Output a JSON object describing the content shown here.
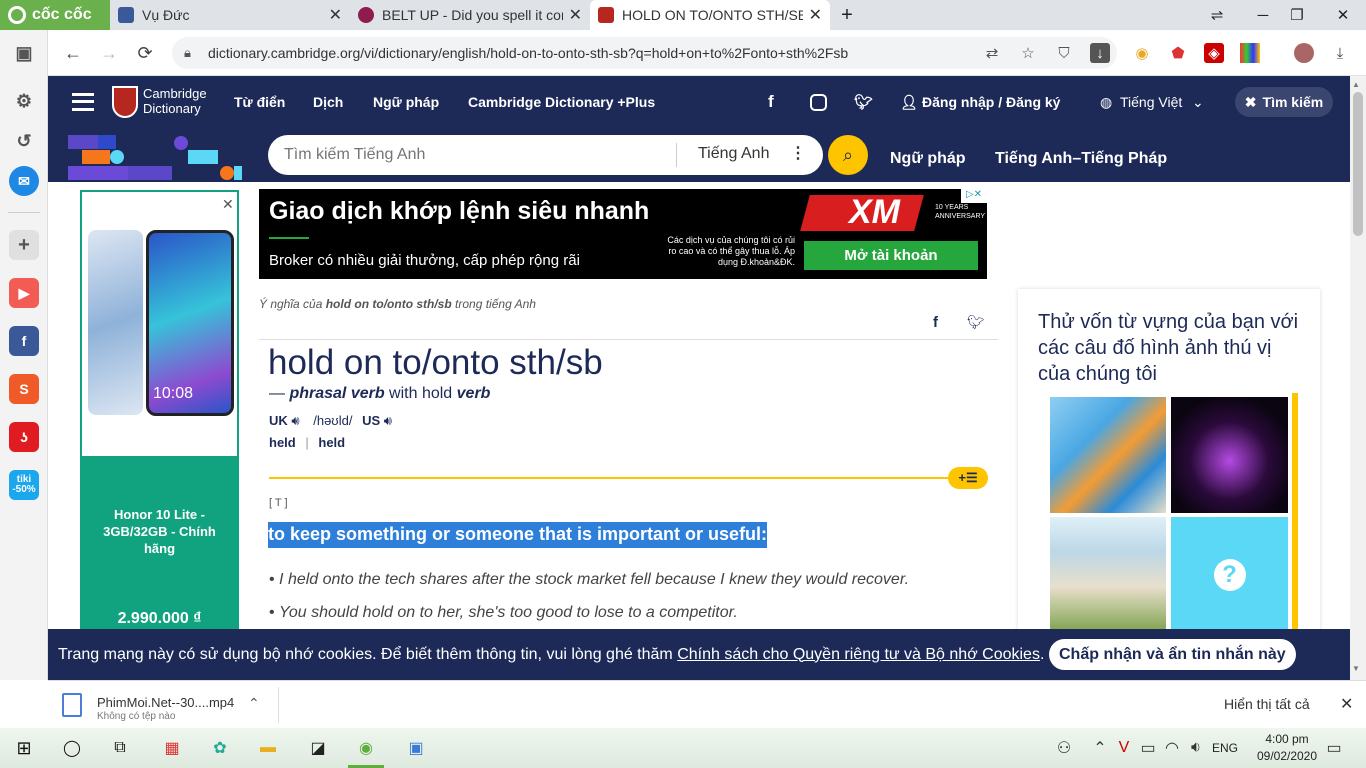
{
  "browser": {
    "logo": "cốc cốc",
    "tabs": [
      {
        "title": "Vụ Đức"
      },
      {
        "title": "BELT UP - Did you spell it corr"
      },
      {
        "title": "HOLD ON TO/ONTO STH/SB"
      }
    ],
    "new_tab": "+",
    "url": "dictionary.cambridge.org/vi/dictionary/english/hold-on-to-onto-sth-sb?q=hold+on+to%2Fonto+sth%2Fsb"
  },
  "site": {
    "logo_line1": "Cambridge",
    "logo_line2": "Dictionary",
    "nav": [
      "Từ điển",
      "Dịch",
      "Ngữ pháp",
      "Cambridge Dictionary +Plus"
    ],
    "login": "Đăng nhập / Đăng ký",
    "language": "Tiếng Việt",
    "search_close": "Tìm kiếm",
    "search_placeholder": "Tìm kiếm Tiếng Anh",
    "search_lang": "Tiếng Anh",
    "links": [
      "Ngữ pháp",
      "Tiếng Anh–Tiếng Pháp"
    ]
  },
  "ad_top": {
    "headline": "Giao dịch khớp lệnh siêu nhanh",
    "sub": "Broker có nhiều giải thưởng, cấp phép rộng rãi",
    "brand": "XM",
    "anniv": "10 YEARS ANNIVERSARY",
    "risk": "Các dịch vụ của chúng tôi có rủi ro cao và có thể gây thua lỗ. Áp dụng Đ.khoản&ĐK.",
    "cta": "Mở tài khoản"
  },
  "ad_left": {
    "phone_time": "10:08",
    "product": "Honor 10 Lite - 3GB/32GB - Chính hãng",
    "price": "2.990.000 ₫"
  },
  "entry": {
    "meaning_prefix": "Ý nghĩa của ",
    "meaning_word": "hold on to/onto sth/sb",
    "meaning_suffix": " trong tiếng Anh",
    "headword": "hold on to/onto sth/sb",
    "pos_dash": "— ",
    "pos": "phrasal verb",
    "with": " with hold ",
    "verb": "verb",
    "uk": "UK",
    "ipa": "/həʊld/",
    "us": "US",
    "forms": [
      "held",
      "held"
    ],
    "grammar": "[ T ]",
    "definition": "to keep something or someone that is important or useful:",
    "examples": [
      "I held onto the tech shares after the stock market fell because I knew they would recover.",
      "You should hold on to her, she's too good to lose to a competitor."
    ]
  },
  "quiz": {
    "title": "Thử vốn từ vựng của bạn với các câu đố hình ảnh thú vị của chúng tôi",
    "question_mark": "?"
  },
  "cookie": {
    "text": "Trang mạng này có sử dụng bộ nhớ cookies. Để biết thêm thông tin, vui lòng ghé thăm ",
    "link": "Chính sách cho Quyền riêng tư và Bộ nhớ Cookies",
    "period": ".",
    "button": "Chấp nhận và ẩn tin nhắn này"
  },
  "download": {
    "filename": "PhimMoi.Net--30....mp4",
    "status": "Không có tệp nào",
    "show_all": "Hiển thị tất cả"
  },
  "taskbar": {
    "lang": "ENG",
    "time": "4:00 pm",
    "date": "09/02/2020"
  },
  "colors": {
    "brand_navy": "#1d2a57",
    "highlight": "#2e7fd9",
    "accent_yellow": "#fec400",
    "xm_green": "#25a73d"
  }
}
